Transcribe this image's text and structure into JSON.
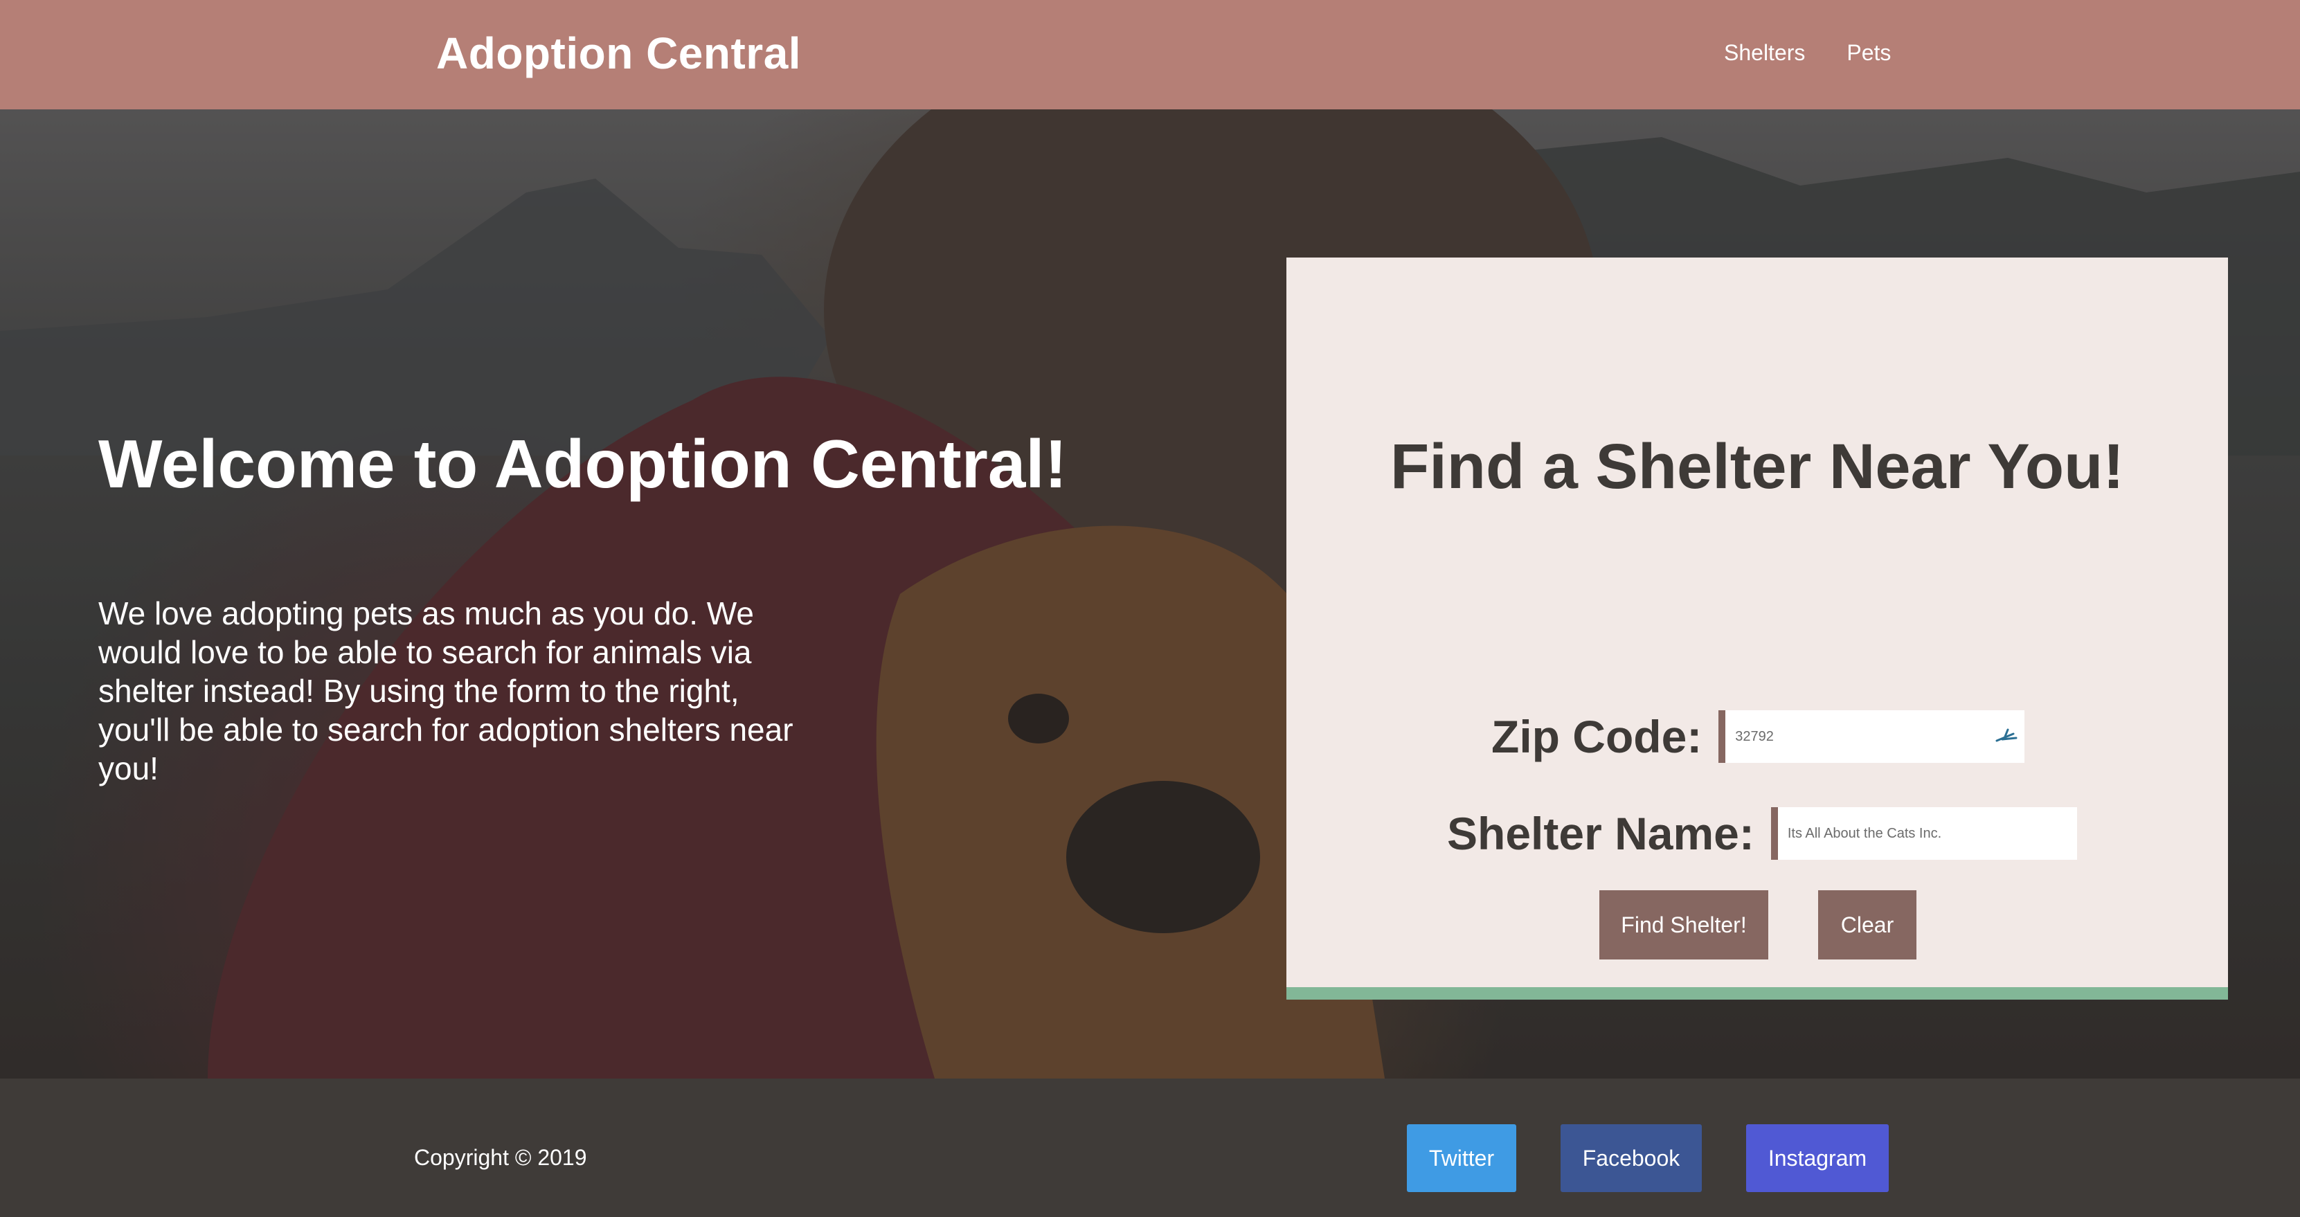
{
  "header": {
    "brand": "Adoption Central",
    "nav": [
      {
        "label": "Shelters"
      },
      {
        "label": "Pets"
      }
    ]
  },
  "hero": {
    "title": "Welcome to Adoption Central!",
    "description": "We love adopting pets as much as you do. We would love to be able to search for animals via shelter instead! By using the form to the right, you'll be able to search for adoption shelters near you!"
  },
  "search_card": {
    "title": "Find a Shelter Near You!",
    "zip": {
      "label": "Zip Code:",
      "placeholder": "32792",
      "icon": "autofill-icon"
    },
    "shelter": {
      "label": "Shelter Name:",
      "placeholder": "Its All About the Cats Inc."
    },
    "find_button": "Find Shelter!",
    "clear_button": "Clear"
  },
  "footer": {
    "copyright": "Copyright © 2019",
    "social": [
      {
        "label": "Twitter",
        "color": "#3f9be4"
      },
      {
        "label": "Facebook",
        "color": "#3c5694"
      },
      {
        "label": "Instagram",
        "color": "#5059d4"
      }
    ]
  },
  "colors": {
    "header_bg": "#b57f76",
    "card_bg": "#f2e9e6",
    "card_accent": "#82b797",
    "button_bg": "#866761",
    "footer_bg": "#3f3b38"
  }
}
